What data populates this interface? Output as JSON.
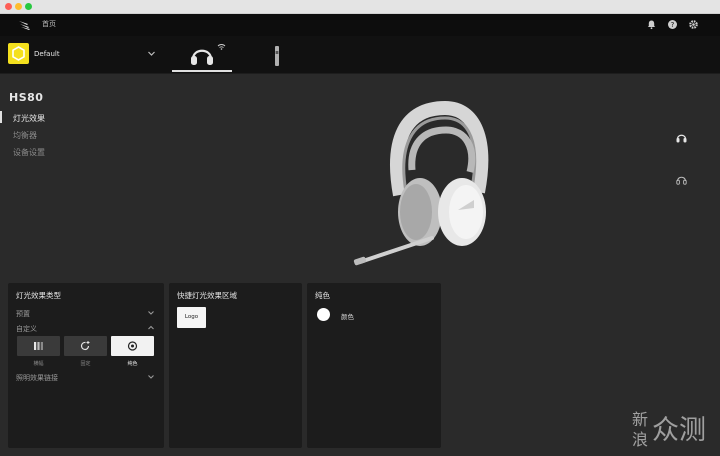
{
  "app": {
    "nav": {
      "home_label": "首页"
    }
  },
  "profile": {
    "name": "Default"
  },
  "device": {
    "title": "HS80",
    "sidebar": [
      {
        "label": "灯光效果",
        "active": true
      },
      {
        "label": "均衡器",
        "active": false
      },
      {
        "label": "设备设置",
        "active": false
      }
    ]
  },
  "panels": {
    "lighting_type": {
      "title": "灯光效果类型",
      "preset_label": "预置",
      "custom_label": "自定义",
      "effects": [
        {
          "label": "横幅",
          "icon": "bars-icon",
          "selected": false
        },
        {
          "label": "固定",
          "icon": "refresh-plus-icon",
          "selected": false
        },
        {
          "label": "纯色",
          "icon": "target-icon",
          "selected": true
        }
      ],
      "link_label": "照明效果链接"
    },
    "quick_zones": {
      "title": "快捷灯光效果区域",
      "zone_button": "Logo"
    },
    "solid_color": {
      "title": "纯色",
      "color_label": "颜色",
      "color_value": "#ffffff"
    }
  },
  "watermark": {
    "line1": "新",
    "line2": "浪",
    "big": "众测"
  },
  "colors": {
    "profile_accent": "#f4e01e",
    "background": "#2a2a2a",
    "panel": "#1c1c1c"
  }
}
